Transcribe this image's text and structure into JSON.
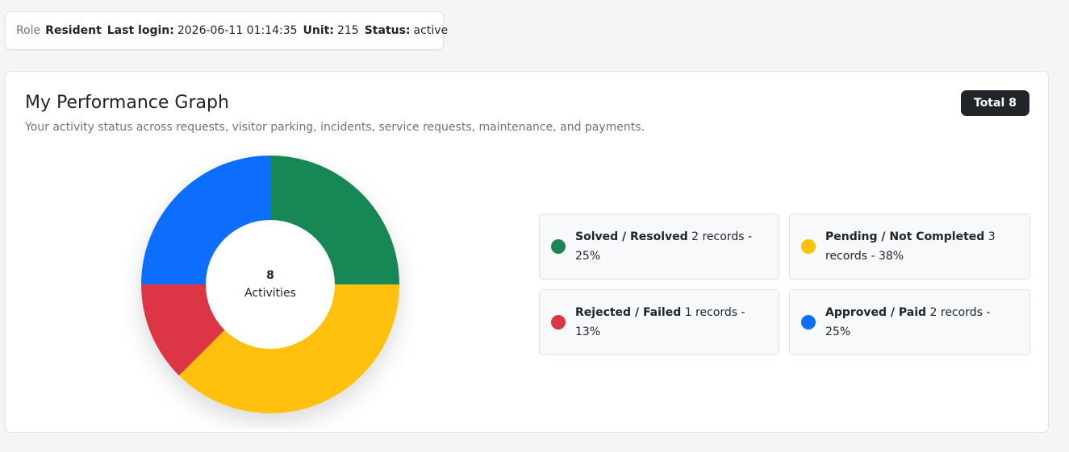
{
  "info": {
    "role_label": "Role",
    "role_value": "Resident",
    "login_label": "Last login:",
    "login_value": "2026-06-11 01:14:35",
    "unit_label": "Unit:",
    "unit_value": "215",
    "status_label": "Status:",
    "status_value": "active"
  },
  "card": {
    "title": "My Performance Graph",
    "subtitle": "Your activity status across requests, visitor parking, incidents, service requests, maintenance, and payments.",
    "total_label": "Total",
    "total_value": "8"
  },
  "donut": {
    "center_number": "8",
    "center_label": "Activities"
  },
  "chart_data": {
    "type": "pie",
    "total": 8,
    "categories": [
      "Solved / Resolved",
      "Pending / Not Completed",
      "Rejected / Failed",
      "Approved / Paid"
    ],
    "values": [
      2,
      3,
      1,
      2
    ],
    "colors": [
      "#198754",
      "#ffc107",
      "#dc3545",
      "#0d6efd"
    ]
  },
  "legend": [
    {
      "name": "Solved / Resolved",
      "detail": "2 records - 25%",
      "color": "#198754"
    },
    {
      "name": "Pending / Not Completed",
      "detail": "3 records - 38%",
      "color": "#ffc107"
    },
    {
      "name": "Rejected / Failed",
      "detail": "1 records - 13%",
      "color": "#dc3545"
    },
    {
      "name": "Approved / Paid",
      "detail": "2 records - 25%",
      "color": "#0d6efd"
    }
  ]
}
